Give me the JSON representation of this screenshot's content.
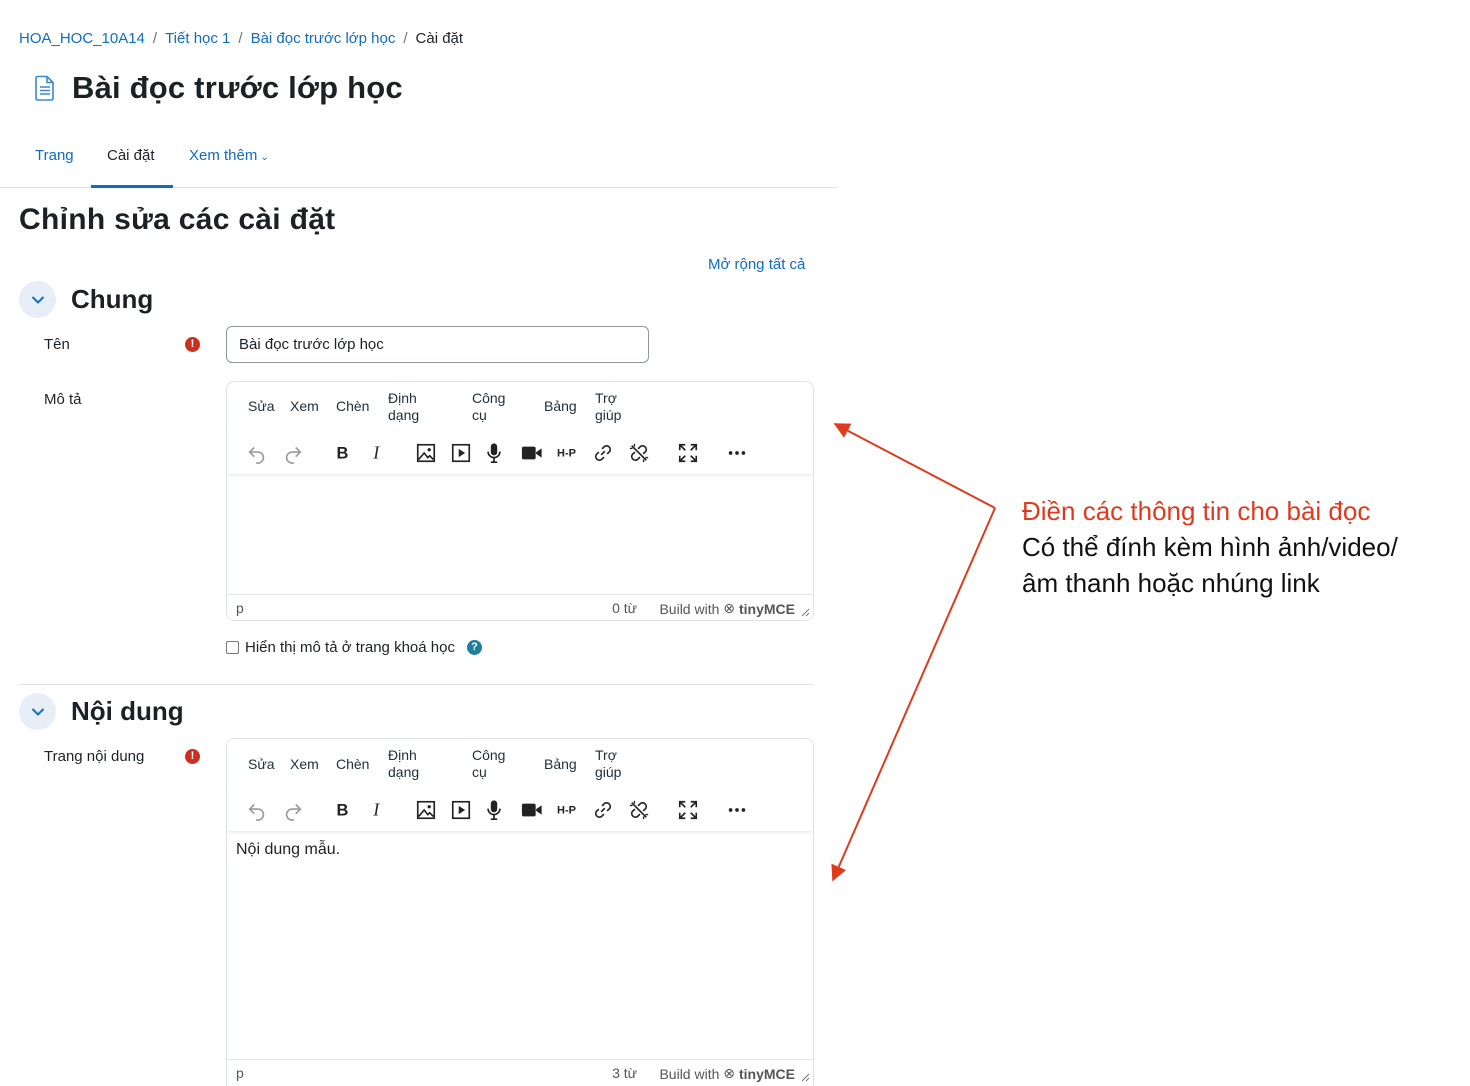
{
  "breadcrumb": {
    "items": [
      "HOA_HOC_10A14",
      "Tiết học 1",
      "Bài đọc trước lớp học"
    ],
    "current": "Cài đặt",
    "separator": "/"
  },
  "page": {
    "title": "Bài đọc trước lớp học",
    "icon": "page-icon"
  },
  "tabs": [
    {
      "label": "Trang",
      "active": false
    },
    {
      "label": "Cài đặt",
      "active": true
    },
    {
      "label": "Xem thêm",
      "active": false,
      "dropdown": true
    }
  ],
  "heading": "Chỉnh sửa các cài đặt",
  "expand_all": "Mở rộng tất cả",
  "sections": {
    "general": {
      "title": "Chung",
      "name_label": "Tên",
      "name_value": "Bài đọc trước lớp học",
      "description_label": "Mô tả",
      "show_description_label": "Hiển thị mô tả ở trang khoá học",
      "show_description_checked": false
    },
    "content": {
      "title": "Nội dung",
      "page_content_label": "Trang nội dung"
    }
  },
  "editor_menu": {
    "edit": "Sửa",
    "view": "Xem",
    "insert": "Chèn",
    "format_1": "Định",
    "format_2": "dạng",
    "tools_1": "Công",
    "tools_2": "cụ",
    "table": "Bảng",
    "help_1": "Trợ",
    "help_2": "giúp"
  },
  "editor_toolbar_icons": [
    "undo-icon",
    "redo-icon",
    "bold-icon",
    "italic-icon",
    "image-icon",
    "media-icon",
    "microphone-icon",
    "video-camera-icon",
    "h5p-icon",
    "link-icon",
    "unlink-icon",
    "fullscreen-icon",
    "more-icon"
  ],
  "editors": {
    "description": {
      "content": "",
      "path": "p",
      "word_count": "0 từ"
    },
    "page_content": {
      "content": "Nội dung mẫu.",
      "path": "p",
      "word_count": "3 từ"
    }
  },
  "editor_branding": {
    "prefix": "Build with",
    "brand": "tinyMCE"
  },
  "annotation": {
    "line1": "Điền các thông tin cho bài đọc",
    "line2": "Có thể đính kèm hình ảnh/video/",
    "line3": "âm thanh hoặc nhúng link"
  },
  "colors": {
    "link": "#0f6cbf",
    "required": "#ca3120",
    "help": "#1f7e9a",
    "annotation_red": "#e03a1e"
  }
}
